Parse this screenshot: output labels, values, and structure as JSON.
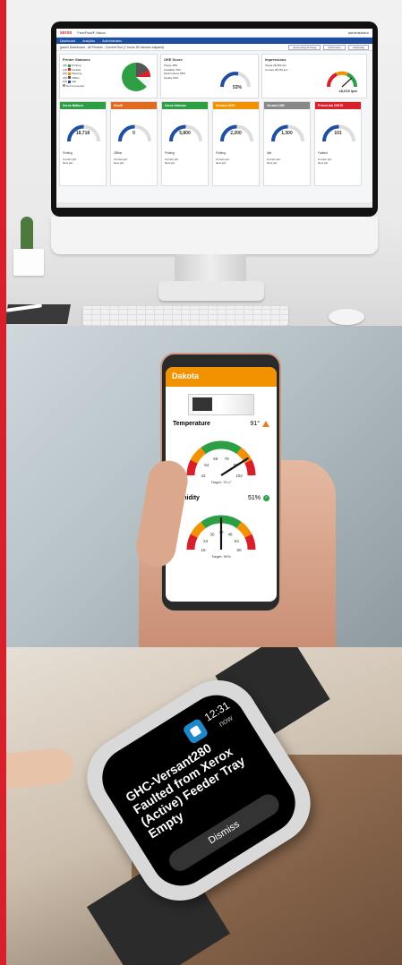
{
  "colors": {
    "accent_red": "#d9202a",
    "nav_blue": "#1f4fa3",
    "phone_header": "#f39200"
  },
  "desktop": {
    "logo": "xerox",
    "app_title": "FreeFlow® Vision",
    "user": "administrator",
    "nav": [
      "Dashboard",
      "Analytics",
      "Administration"
    ],
    "subheader": "jpaul's Dashboard - All Printers - Current Run (7 hours 53 minutes elapsed)",
    "controls": [
      "Accounting Printing",
      "All Printers",
      "Yesterday"
    ],
    "printer_statuses": {
      "title": "Printer Statuses",
      "items": [
        {
          "count": "4(5)",
          "label": "Printing",
          "color": "#2e9e44"
        },
        {
          "count": "1(6)",
          "label": "Faulted",
          "color": "#d9202a"
        },
        {
          "count": "0(0)",
          "label": "Warning",
          "color": "#f39200"
        },
        {
          "count": "2(5)",
          "label": "Offline",
          "color": "#555555"
        },
        {
          "count": "1(5)",
          "label": "Idle",
          "color": "#1f4fa3"
        },
        {
          "count": "",
          "label": "Not Connected",
          "color": "#999999"
        }
      ]
    },
    "oee": {
      "title": "OEE Score",
      "rows": [
        {
          "k": "Target",
          "v": "48%"
        },
        {
          "k": "Available",
          "v": "79%"
        },
        {
          "k": "Performance",
          "v": "85%"
        },
        {
          "k": "Quality",
          "v": "94%"
        }
      ],
      "value": "53%"
    },
    "impressions": {
      "title": "Impressions",
      "rows": [
        {
          "k": "Target",
          "v": "28,350 ipm"
        },
        {
          "k": "Current",
          "v": "28,615 ipm"
        }
      ],
      "value": "28,615 ipm"
    },
    "printers": [
      {
        "name": "Xerox Baltoro",
        "color": "#2e9e44",
        "value": "18,718",
        "status": "Printing"
      },
      {
        "name": "iGen5",
        "color": "#e06a1f",
        "value": "0",
        "status": "Offline"
      },
      {
        "name": "Xerox Iridesse",
        "color": "#2e9e44",
        "value": "5,800",
        "status": "Printing"
      },
      {
        "name": "Versant 4100",
        "color": "#f39200",
        "value": "2,200",
        "status": "Printing"
      },
      {
        "name": "Versant 280",
        "color": "#888888",
        "value": "1,300",
        "status": "Idle"
      },
      {
        "name": "PrimeLink C9070",
        "color": "#d9202a",
        "value": "101",
        "status": "Faulted"
      }
    ],
    "job_labels": {
      "current": "Current job:",
      "next": "Next job:",
      "completed": "Completed jobs:"
    }
  },
  "phone": {
    "title": "Dakota",
    "temperature": {
      "label": "Temperature",
      "value": "91°",
      "target": "Target: 75 o°",
      "ticks": [
        "42",
        "54",
        "66",
        "78",
        "90",
        "102"
      ],
      "needle_frac": 0.82
    },
    "humidity": {
      "label": "Humidity",
      "value": "51%",
      "target": "Target: 50%",
      "ticks": [
        "18",
        "24",
        "30",
        "42",
        "48",
        "54",
        "60"
      ],
      "needle_frac": 0.5
    }
  },
  "watch": {
    "time": "12:31",
    "now": "now",
    "message": "GHC-Versant280 Faulted from Xerox (Active) Feeder Tray Empty",
    "dismiss": "Dismiss"
  }
}
